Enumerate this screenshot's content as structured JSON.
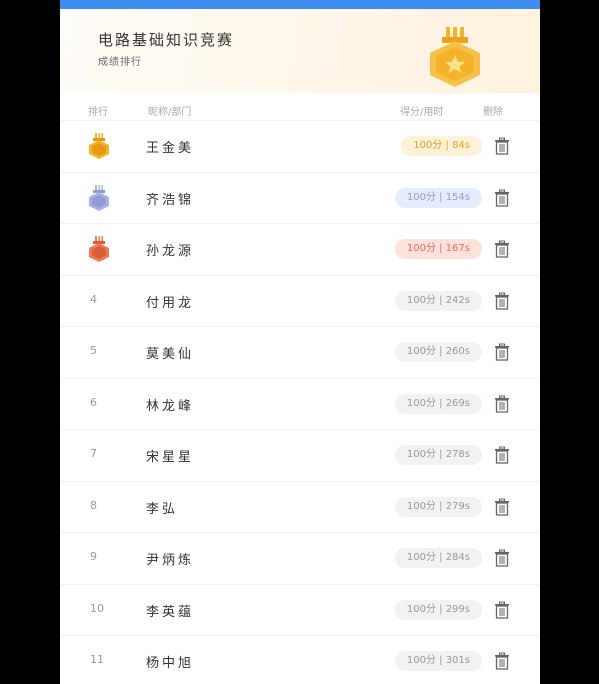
{
  "header": {
    "title": "电路基础知识竞赛",
    "subtitle": "成绩排行",
    "trophy_icon": "trophy-medal-icon"
  },
  "columns": {
    "rank": "排行",
    "name": "昵称/部门",
    "score": "得分/用时",
    "delete": "删除"
  },
  "colors": {
    "topbar": "#3d8ef0",
    "gold": "#f4b42a",
    "silver": "#aab3e8",
    "bronze": "#ee7a54"
  },
  "rows": [
    {
      "rank": "1",
      "name": "王金美",
      "score": "100分 | 84s",
      "tier": "gold"
    },
    {
      "rank": "2",
      "name": "齐浩锦",
      "score": "100分 | 154s",
      "tier": "silver"
    },
    {
      "rank": "3",
      "name": "孙龙源",
      "score": "100分 | 167s",
      "tier": "bronze"
    },
    {
      "rank": "4",
      "name": "付用龙",
      "score": "100分 | 242s",
      "tier": ""
    },
    {
      "rank": "5",
      "name": "莫美仙",
      "score": "100分 | 260s",
      "tier": ""
    },
    {
      "rank": "6",
      "name": "林龙峰",
      "score": "100分 | 269s",
      "tier": ""
    },
    {
      "rank": "7",
      "name": "宋星星",
      "score": "100分 | 278s",
      "tier": ""
    },
    {
      "rank": "8",
      "name": "李弘",
      "score": "100分 | 279s",
      "tier": ""
    },
    {
      "rank": "9",
      "name": "尹炳炼",
      "score": "100分 | 284s",
      "tier": ""
    },
    {
      "rank": "10",
      "name": "李英蕴",
      "score": "100分 | 299s",
      "tier": ""
    },
    {
      "rank": "11",
      "name": "杨中旭",
      "score": "100分 | 301s",
      "tier": ""
    }
  ]
}
